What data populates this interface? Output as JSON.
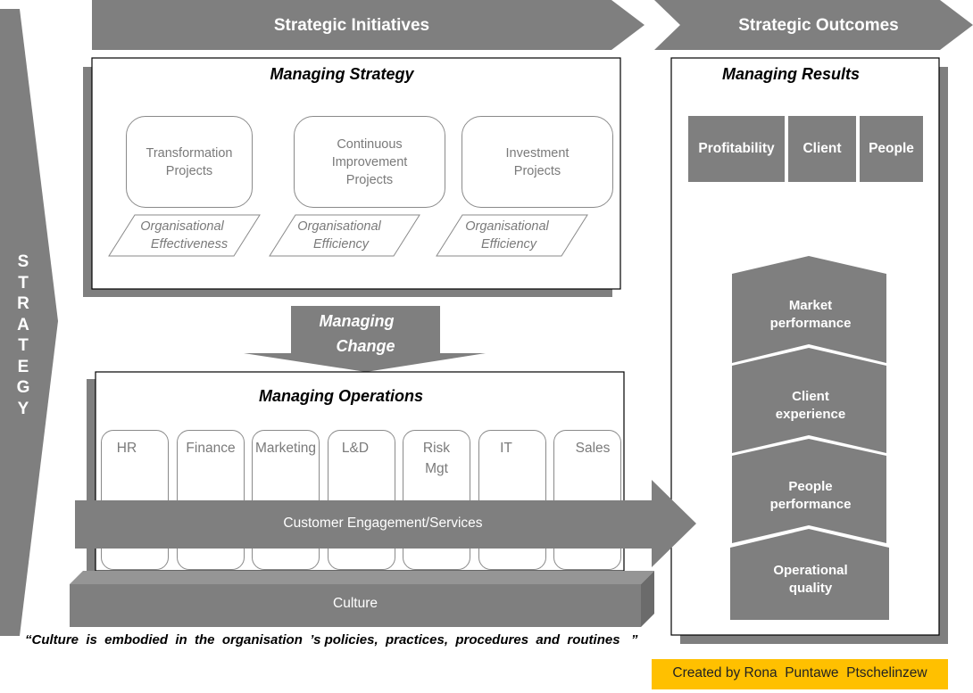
{
  "header": {
    "initiatives_label": "Strategic Initiatives",
    "outcomes_label": "Strategic Outcomes"
  },
  "strategy_arrow": {
    "letters": [
      "S",
      "T",
      "R",
      "A",
      "T",
      "E",
      "G",
      "Y"
    ]
  },
  "managing_strategy": {
    "title": "Managing Strategy",
    "projects": [
      {
        "line1": "Transformation",
        "line2": "Projects",
        "line3": ""
      },
      {
        "line1": "Continuous",
        "line2": "Improvement",
        "line3": "Projects"
      },
      {
        "line1": "Investment",
        "line2": "Projects",
        "line3": ""
      }
    ],
    "outcomes": [
      {
        "line1": "Organisational",
        "line2": "Effectiveness"
      },
      {
        "line1": "Organisational",
        "line2": "Efficiency"
      },
      {
        "line1": "Organisational",
        "line2": "Efficiency"
      }
    ]
  },
  "managing_change": {
    "line1": "Managing",
    "line2": "Change"
  },
  "managing_operations": {
    "title": "Managing Operations",
    "departments": [
      {
        "line1": "HR",
        "line2": ""
      },
      {
        "line1": "Finance",
        "line2": ""
      },
      {
        "line1": "Marketing",
        "line2": ""
      },
      {
        "line1": "L&D",
        "line2": ""
      },
      {
        "line1": "Risk",
        "line2": "Mgt"
      },
      {
        "line1": "IT",
        "line2": ""
      },
      {
        "line1": "Sales",
        "line2": ""
      }
    ],
    "customer_arrow_label": "Customer  Engagement/Services",
    "culture_label": "Culture"
  },
  "managing_results": {
    "title": "Managing Results",
    "categories": [
      "Profitability",
      "Client",
      "People"
    ],
    "stack": [
      {
        "line1": "Market",
        "line2": "performance"
      },
      {
        "line1": "Client",
        "line2": "experience"
      },
      {
        "line1": "People",
        "line2": "performance"
      },
      {
        "line1": "Operational",
        "line2": "quality"
      }
    ]
  },
  "quote": "“Culture  is  embodied  in  the  organisation  ’s policies,  practices,  procedures  and  routines   ”",
  "credit": "Created by Rona  Puntawe  Ptschelinzew",
  "colors": {
    "shape_gray": "#7f7f7f",
    "shape_light_gray": "#959595",
    "shape_dark_gray": "#6b6b6b",
    "outline_gray": "#8a8a8a",
    "text_gray": "#7a7a7a",
    "credit_yellow": "#ffc000"
  }
}
